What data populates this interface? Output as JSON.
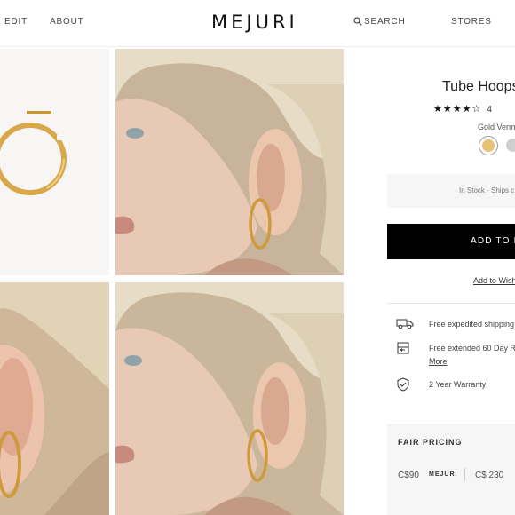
{
  "header": {
    "nav_left": [
      "E EDIT",
      "ABOUT"
    ],
    "logo": "MEJURI",
    "search_label": "SEARCH",
    "stores_label": "STORES"
  },
  "product": {
    "title": "Tube Hoops",
    "rating": 4,
    "review_count": "4",
    "variant_label": "Gold Verm",
    "swatches": [
      {
        "name": "gold",
        "color": "#e6c374",
        "selected": true
      },
      {
        "name": "silver",
        "color": "#cfcfcf",
        "selected": false
      }
    ],
    "stock_text": "In Stock - Ships c",
    "add_to_bag": "ADD TO B",
    "add_to_wishlist": "Add to Wish",
    "perks": [
      {
        "icon": "truck-icon",
        "text": "Free expedited shipping c"
      },
      {
        "icon": "return-box-icon",
        "text": "Free extended 60 Day R",
        "link": "More"
      },
      {
        "icon": "shield-check-icon",
        "text": "2 Year Warranty"
      }
    ],
    "fair_pricing": {
      "title": "FAIR PRICING",
      "our_price": "C$90",
      "brand": "MEJURI",
      "traditional_price": "C$ 230"
    }
  },
  "colors": {
    "accent_gold": "#e6c374",
    "button_black": "#000000"
  }
}
